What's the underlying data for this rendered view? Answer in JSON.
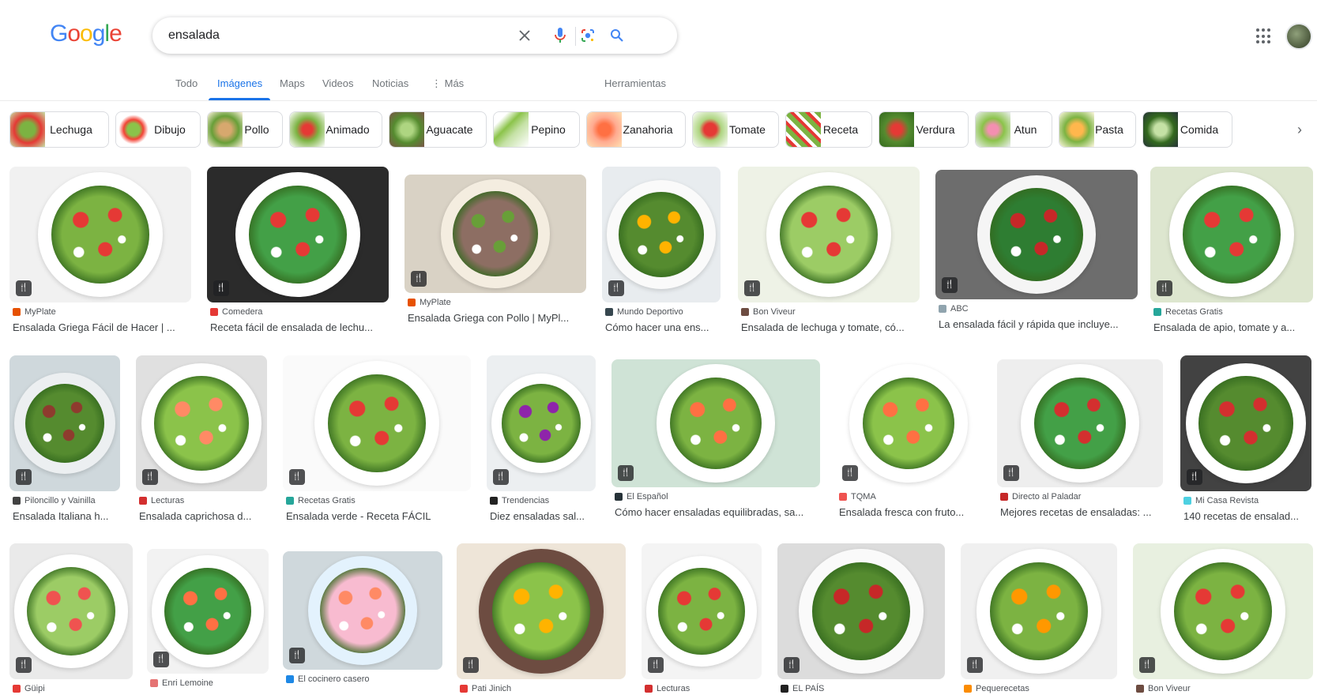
{
  "logo": {
    "letters": [
      "G",
      "o",
      "o",
      "g",
      "l",
      "e"
    ],
    "colors": [
      "#4285F4",
      "#EA4335",
      "#FBBC05",
      "#4285F4",
      "#34A853",
      "#EA4335"
    ]
  },
  "search": {
    "query": "ensalada"
  },
  "tabs": [
    {
      "label": "Todo",
      "active": false
    },
    {
      "label": "Imágenes",
      "active": true
    },
    {
      "label": "Maps",
      "active": false
    },
    {
      "label": "Videos",
      "active": false
    },
    {
      "label": "Noticias",
      "active": false
    },
    {
      "label": "⋮ Más",
      "active": false
    },
    {
      "label": "Herramientas",
      "active": false
    }
  ],
  "chips": [
    "Lechuga",
    "Dibujo",
    "Pollo",
    "Animado",
    "Aguacate",
    "Pepino",
    "Zanahoria",
    "Tomate",
    "Receta",
    "Verdura",
    "Atun",
    "Pasta",
    "Comida"
  ],
  "results": [
    {
      "source": "MyPlate",
      "title": "Ensalada Griega Fácil de Hacer | ...",
      "icon": "#e65100"
    },
    {
      "source": "Comedera",
      "title": "Receta fácil de ensalada de lechu...",
      "icon": "#e53935"
    },
    {
      "source": "MyPlate",
      "title": "Ensalada Griega con Pollo | MyPl...",
      "icon": "#e65100"
    },
    {
      "source": "Mundo Deportivo",
      "title": "Cómo hacer una ens...",
      "icon": "#37474f"
    },
    {
      "source": "Bon Viveur",
      "title": "Ensalada de lechuga y tomate, có...",
      "icon": "#6d4c41"
    },
    {
      "source": "ABC",
      "title": "La ensalada fácil y rápida que incluye...",
      "icon": "#90a4ae"
    },
    {
      "source": "Recetas Gratis",
      "title": "Ensalada de apio, tomate y a...",
      "icon": "#26a69a"
    },
    {
      "source": "Piloncillo y Vainilla",
      "title": "Ensalada Italiana h...",
      "icon": "#424242"
    },
    {
      "source": "Lecturas",
      "title": "Ensalada caprichosa d...",
      "icon": "#d32f2f"
    },
    {
      "source": "Recetas Gratis",
      "title": "Ensalada verde - Receta FÁCIL",
      "icon": "#26a69a"
    },
    {
      "source": "Trendencias",
      "title": "Diez ensaladas sal...",
      "icon": "#212121"
    },
    {
      "source": "El Español",
      "title": "Cómo hacer ensaladas equilibradas, sa...",
      "icon": "#263238"
    },
    {
      "source": "TQMA",
      "title": "Ensalada fresca con fruto...",
      "icon": "#ef5350"
    },
    {
      "source": "Directo al Paladar",
      "title": "Mejores recetas de ensaladas: ...",
      "icon": "#c62828"
    },
    {
      "source": "Mi Casa Revista",
      "title": "140 recetas de ensalad...",
      "icon": "#4dd0e1"
    },
    {
      "source": "Güipi",
      "title": "",
      "icon": "#e53935"
    },
    {
      "source": "Enri Lemoine",
      "title": "",
      "icon": "#e57373"
    },
    {
      "source": "El cocinero casero",
      "title": "",
      "icon": "#1e88e5"
    },
    {
      "source": "Pati Jinich",
      "title": "",
      "icon": "#e53935"
    },
    {
      "source": "Lecturas",
      "title": "",
      "icon": "#d32f2f"
    },
    {
      "source": "EL PAÍS",
      "title": "",
      "icon": "#212121"
    },
    {
      "source": "Pequerecetas",
      "title": "",
      "icon": "#fb8c00"
    },
    {
      "source": "Bon Viveur",
      "title": "",
      "icon": "#6d4c41"
    }
  ]
}
